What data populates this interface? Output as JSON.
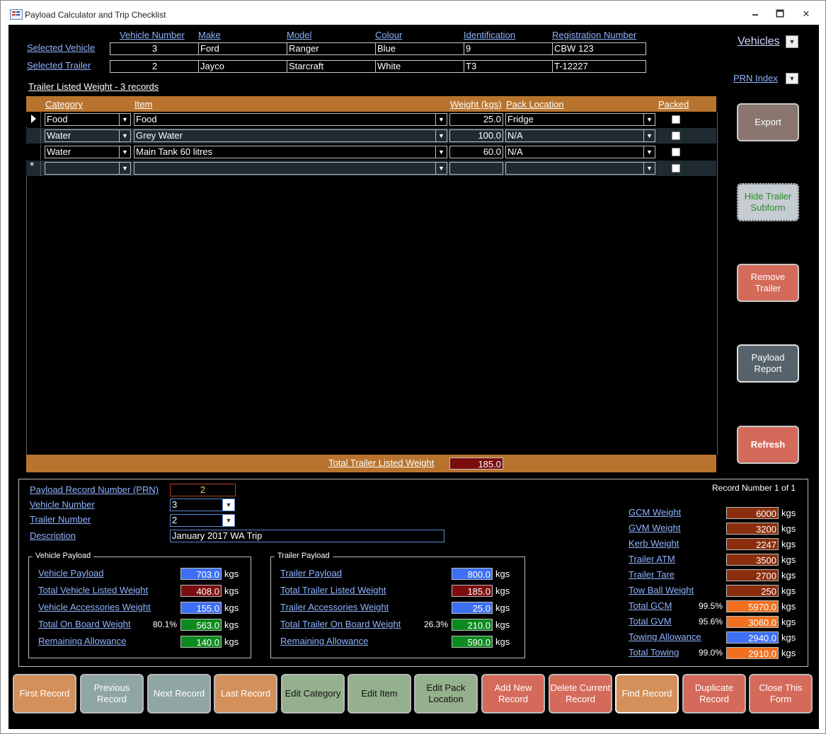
{
  "window": {
    "title": "Payload Calculator and Trip Checklist",
    "min": "🗕",
    "max": "🗖",
    "close": "✕"
  },
  "header": {
    "cols": [
      "Vehicle Number",
      "Make",
      "Model",
      "Colour",
      "Identification",
      "Registration Number"
    ],
    "selected_vehicle_label": "Selected Vehicle",
    "selected_trailer_label": "Selected Trailer",
    "vehicle": {
      "number": "3",
      "make": "Ford",
      "model": "Ranger",
      "colour": "Blue",
      "identification": "9",
      "registration": "CBW 123"
    },
    "trailer": {
      "number": "2",
      "make": "Jayco",
      "model": "Starcraft",
      "colour": "White",
      "identification": "T3",
      "registration": "T-12227"
    },
    "vehicles_link": "Vehicles",
    "prn_index_link": "PRN Index"
  },
  "subform": {
    "title": "Trailer Listed Weight - 3 records",
    "columns": {
      "category": "Category",
      "item": "Item",
      "weight": "Weight (kgs)",
      "location": "Pack Location",
      "packed": "Packed"
    },
    "rows": [
      {
        "category": "Food",
        "item": "Food",
        "weight": "25.0",
        "location": "Fridge"
      },
      {
        "category": "Water",
        "item": "Grey Water",
        "weight": "100.0",
        "location": "N/A"
      },
      {
        "category": "Water",
        "item": "Main Tank 60 litres",
        "weight": "60.0",
        "location": "N/A"
      },
      {
        "category": "",
        "item": "",
        "weight": "",
        "location": ""
      }
    ],
    "total_label": "Total Trailer Listed Weight",
    "total_value": "185.0"
  },
  "side_buttons": {
    "export": "Export",
    "hide_trailer": "Hide Trailer Subform",
    "remove_trailer": "Remove Trailer",
    "payload_report": "Payload Report",
    "refresh": "Refresh"
  },
  "record": {
    "prn_label": "Payload Record Number (PRN)",
    "prn_value": "2",
    "vehicle_number_label": "Vehicle Number",
    "vehicle_number_value": "3",
    "trailer_number_label": "Trailer Number",
    "trailer_number_value": "2",
    "description_label": "Description",
    "description_value": "January 2017 WA Trip",
    "record_number": "Record Number 1 of 1"
  },
  "vehicle_payload": {
    "legend": "Vehicle Payload",
    "rows": [
      {
        "label": "Vehicle Payload",
        "value": "703.0",
        "pct": ""
      },
      {
        "label": "Total Vehicle Listed Weight",
        "value": "408.0",
        "pct": ""
      },
      {
        "label": "Vehicle Accessories Weight",
        "value": "155.0",
        "pct": ""
      },
      {
        "label": "Total On Board Weight",
        "value": "563.0",
        "pct": "80.1%"
      },
      {
        "label": "Remaining Allowance",
        "value": "140.0",
        "pct": ""
      }
    ]
  },
  "trailer_payload": {
    "legend": "Trailer Payload",
    "rows": [
      {
        "label": "Trailer Payload",
        "value": "800.0",
        "pct": ""
      },
      {
        "label": "Total Trailer Listed Weight",
        "value": "185.0",
        "pct": ""
      },
      {
        "label": "Trailer Accessories Weight",
        "value": "25.0",
        "pct": ""
      },
      {
        "label": "Total Trailer On Board Weight",
        "value": "210.0",
        "pct": "26.3%"
      },
      {
        "label": "Remaining Allowance",
        "value": "590.0",
        "pct": ""
      }
    ]
  },
  "unit": "kgs",
  "weights": [
    {
      "label": "GCM Weight",
      "value": "6000",
      "pct": ""
    },
    {
      "label": "GVM Weight",
      "value": "3200",
      "pct": ""
    },
    {
      "label": "Kerb Weight",
      "value": "2247",
      "pct": ""
    },
    {
      "label": "Trailer ATM",
      "value": "3500",
      "pct": ""
    },
    {
      "label": "Trailer Tare",
      "value": "2700",
      "pct": ""
    },
    {
      "label": "Tow Ball Weight",
      "value": "250",
      "pct": ""
    },
    {
      "label": "Total GCM",
      "value": "5970.0",
      "pct": "99.5%"
    },
    {
      "label": "Total GVM",
      "value": "3060.0",
      "pct": "95.6%"
    },
    {
      "label": "Towing Allowance",
      "value": "2940.0",
      "pct": ""
    },
    {
      "label": "Total Towing",
      "value": "2910.0",
      "pct": "99.0%"
    }
  ],
  "nav_buttons": [
    "First Record",
    "Previous Record",
    "Next Record",
    "Last Record",
    "Edit Category",
    "Edit Item",
    "Edit Pack Location",
    "Add New Record",
    "Delete Current Record",
    "Find Record",
    "Duplicate Record",
    "Close This Form"
  ],
  "colors": {
    "orange_header": "#b8742e",
    "blue_value": "#3d6ff5",
    "red_value": "#7a0e0e",
    "green_value": "#0d8a1f",
    "brown_value": "#8b2e0d",
    "orange_value": "#f0701f"
  }
}
